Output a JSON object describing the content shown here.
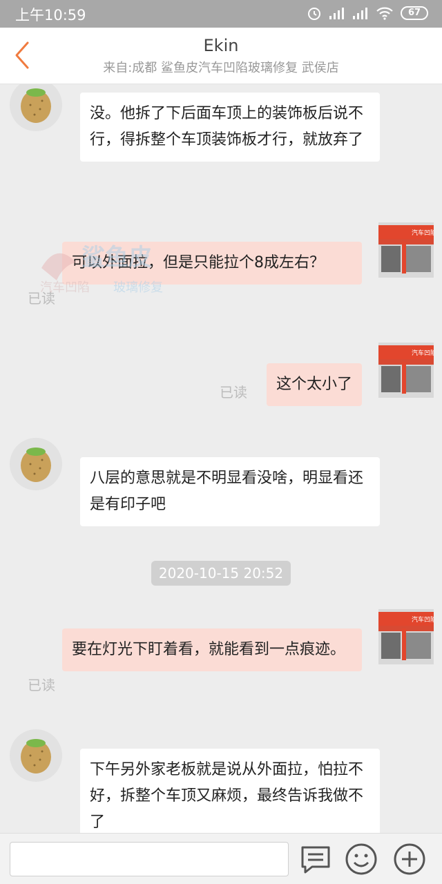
{
  "status": {
    "time": "上午10:59",
    "battery": "67"
  },
  "header": {
    "title": "Ekin",
    "subtitle": "来自:成都 鲨鱼皮汽车凹陷玻璃修复 武侯店"
  },
  "messages": [
    {
      "side": "in",
      "text": "没。他拆了下后面车顶上的装饰板后说不行，得拆整个车顶装饰板才行，就放弃了"
    },
    {
      "side": "out",
      "text": "可以外面拉，但是只能拉个8成左右？",
      "read": "已读"
    },
    {
      "side": "out",
      "text": "这个太小了",
      "read": "已读"
    },
    {
      "side": "in",
      "text": "八层的意思就是不明显看没啥，明显看还是有印子吧"
    },
    {
      "side": "out",
      "text": "要在灯光下盯着看，就能看到一点痕迹。",
      "read": "已读"
    },
    {
      "side": "in",
      "text": "下午另外家老板就是说从外面拉，怕拉不好，拆整个车顶又麻烦，最终告诉我做不了"
    }
  ],
  "timestamp": "2020-10-15 20:52",
  "watermark": {
    "brand": "鲨鱼皮",
    "line1": "汽车凹陷",
    "line2": "玻璃修复"
  },
  "store_sign": "汽车凹陷修",
  "icons": [
    "back-icon",
    "alarm-icon",
    "signal-icon",
    "wifi-icon",
    "battery-icon",
    "quick-reply-icon",
    "emoji-icon",
    "plus-icon"
  ]
}
